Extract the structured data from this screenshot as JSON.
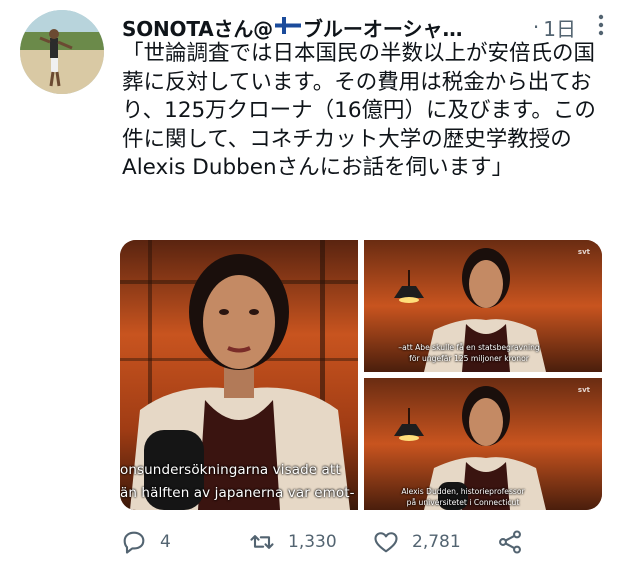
{
  "tweet": {
    "display_name": "SONOTAさん@",
    "name_suffix": "ブルーオーシャ…",
    "separator": "·",
    "timestamp": "1日",
    "more_icon": "ellipsis-vertical-icon",
    "text": "「世論調査では日本国民の半数以上が安倍氏の国葬に反対しています。その費用は税金から出ており、125万クローナ（16億円）に及びます。この件に関して、コネチカット大学の歴史学教授のAlexis Dubbenさんにお話を伺います」",
    "flag_icon": "finland-flag-icon"
  },
  "media": {
    "frame1": {
      "subtitle_line1": "onsundersökningarna visade att",
      "subtitle_line2": "än hälften av japanerna var emot-"
    },
    "frame2": {
      "subtitle_line1": "–att Abe skulle få en statsbegravning",
      "subtitle_line2": "för ungefär 125 miljoner kronor",
      "logo": "svt"
    },
    "frame3": {
      "subtitle_line1": "Alexis Dudden, historieprofessor",
      "subtitle_line2": "på universitetet i Connecticut",
      "logo": "svt"
    }
  },
  "actions": {
    "reply": {
      "icon": "reply-icon",
      "count": "4"
    },
    "retweet": {
      "icon": "retweet-icon",
      "count": "1,330"
    },
    "like": {
      "icon": "heart-icon",
      "count": "2,781"
    },
    "share": {
      "icon": "share-icon",
      "count": ""
    }
  },
  "colors": {
    "text": "#0f1419",
    "muted": "#536471",
    "studio_orange": "#c8541f"
  }
}
